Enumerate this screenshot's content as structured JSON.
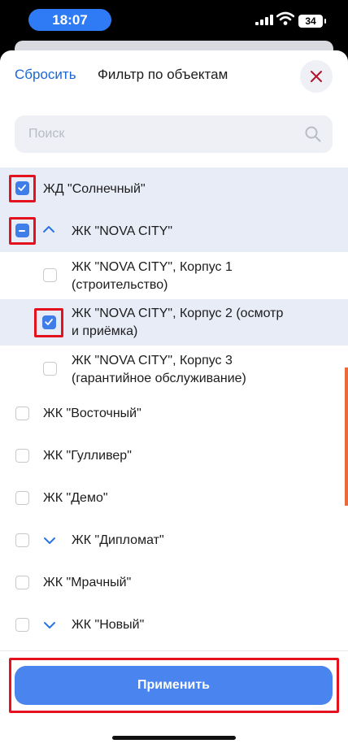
{
  "status_bar": {
    "time": "18:07",
    "battery": "34"
  },
  "header": {
    "reset_label": "Сбросить",
    "title": "Фильтр по объектам"
  },
  "search": {
    "placeholder": "Поиск",
    "value": ""
  },
  "items": [
    {
      "label": "ЖД \"Солнечный\"",
      "checked": true,
      "expanded": null
    },
    {
      "label": "ЖК \"NOVA CITY\"",
      "checked": "partial",
      "expanded": true
    },
    {
      "label_line1": "ЖК \"NOVA CITY\", Корпус 1",
      "label_line2": "(строительство)",
      "checked": false,
      "child": true
    },
    {
      "label_line1": "ЖК \"NOVA CITY\", Корпус 2 (осмотр",
      "label_line2": "и приёмка)",
      "checked": true,
      "child": true
    },
    {
      "label_line1": "ЖК \"NOVA CITY\", Корпус 3",
      "label_line2": "(гарантийное обслуживание)",
      "checked": false,
      "child": true
    },
    {
      "label": "ЖК \"Восточный\"",
      "checked": false
    },
    {
      "label": "ЖК \"Гулливер\"",
      "checked": false
    },
    {
      "label": "ЖК \"Демо\"",
      "checked": false
    },
    {
      "label": "ЖК \"Дипломат\"",
      "checked": false,
      "expanded": false
    },
    {
      "label": "ЖК \"Мрачный\"",
      "checked": false
    },
    {
      "label": "ЖК \"Новый\"",
      "checked": false,
      "expanded": false
    }
  ],
  "footer": {
    "apply_label": "Применить"
  },
  "colors": {
    "accent": "#3f7de8",
    "highlight": "#e3121e",
    "link": "#1a66d6",
    "selected_row": "#e8ecf6"
  }
}
